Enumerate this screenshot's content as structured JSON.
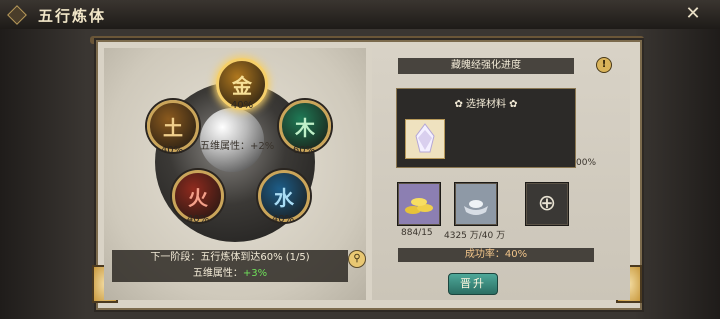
{
  "header": {
    "title": "五行炼体",
    "close_icon": "close-cross-icon"
  },
  "elements": [
    {
      "key": "metal",
      "label": "金",
      "percent": "40%",
      "color": "#b0781e",
      "text_color": "#f6df96",
      "active": true
    },
    {
      "key": "wood",
      "label": "木",
      "percent": "60%",
      "color": "#1f7a56",
      "text_color": "#bff0c8",
      "active": false
    },
    {
      "key": "earth",
      "label": "土",
      "percent": "40%",
      "color": "#8b5a1e",
      "text_color": "#f0cf8c",
      "active": false
    },
    {
      "key": "fire",
      "label": "火",
      "percent": "40%",
      "color": "#8f2a1e",
      "text_color": "#f4a08a",
      "active": false
    },
    {
      "key": "water",
      "label": "水",
      "percent": "40%",
      "color": "#1d5d88",
      "text_color": "#a9dcf4",
      "active": false
    }
  ],
  "left": {
    "attr_label": "五维属性：+2%",
    "next_stage": "下一阶段：五行炼体到达60% (1/5)",
    "attr_next_prefix": "五维属性：",
    "attr_next_value": "+3%"
  },
  "right": {
    "progress_title": "藏魄经强化进度",
    "popup_title": "选择材料",
    "popup_side_text": "00%",
    "slots": [
      {
        "name": "gold-ingots",
        "count": "884/15"
      },
      {
        "name": "silver-ingot",
        "count": "4325 万/40 万"
      },
      {
        "name": "add-slot",
        "count": ""
      }
    ],
    "success_rate": "成功率：40%",
    "upgrade_label": "晋升"
  },
  "colors": {
    "accent_gold": "#caa55a",
    "panel_dark": "#2c2a28",
    "upgrade_teal": "#3a8a7d"
  }
}
